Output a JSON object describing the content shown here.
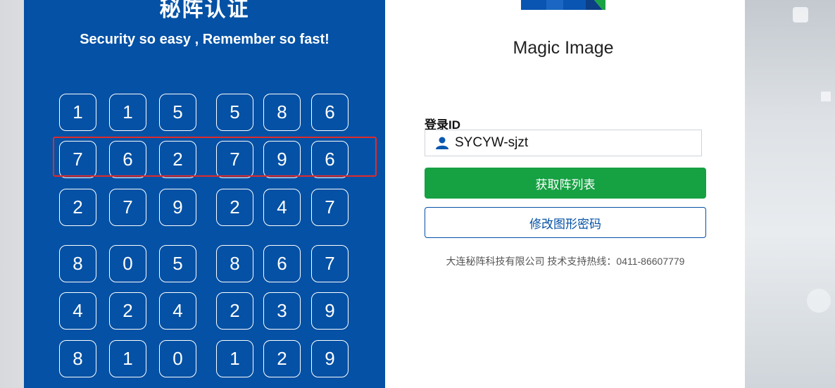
{
  "header": {
    "title": "秘阵认证",
    "subtitle": "Security so easy , Remember so fast!"
  },
  "grid": {
    "rows": [
      [
        "1",
        "1",
        "5",
        "5",
        "8",
        "6"
      ],
      [
        "7",
        "6",
        "2",
        "7",
        "9",
        "6"
      ],
      [
        "2",
        "7",
        "9",
        "2",
        "4",
        "7"
      ],
      [
        "8",
        "0",
        "5",
        "8",
        "6",
        "7"
      ],
      [
        "4",
        "2",
        "4",
        "2",
        "3",
        "9"
      ],
      [
        "8",
        "1",
        "0",
        "1",
        "2",
        "9"
      ]
    ],
    "highlighted_row": 2
  },
  "logo": {
    "text": "Magic Image",
    "icon": "magic-image-logo-icon"
  },
  "login": {
    "label": "登录ID",
    "user_icon": "user-icon",
    "id_value": "SYCYW-sjzt"
  },
  "buttons": {
    "get_matrix": "获取阵列表",
    "change_password": "修改图形密码"
  },
  "footer": {
    "text": "大连秘阵科技有限公司 技术支持热线：0411-86607779"
  },
  "colors": {
    "panel_blue": "#0451a5",
    "button_green": "#16a143",
    "highlight_red": "#e02b2b"
  }
}
